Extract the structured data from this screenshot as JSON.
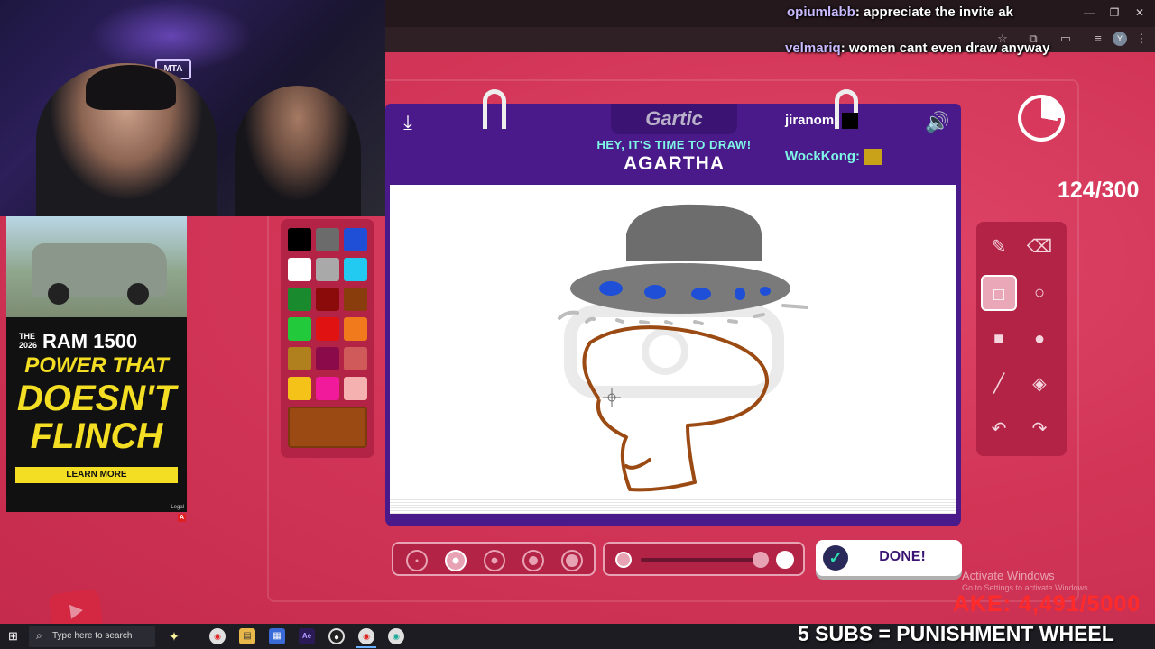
{
  "overlay_chat": [
    {
      "user": "opiumlabb",
      "message": "appreciate the invite ak"
    },
    {
      "user": "velmariq",
      "message": "women cant even draw anyway"
    }
  ],
  "game": {
    "logo": "Gartic",
    "prompt_heading": "HEY, IT'S TIME TO DRAW!",
    "word": "AGARTHA",
    "players": [
      {
        "name": "jiranom:"
      },
      {
        "name": "WockKong:"
      }
    ],
    "done_label": "DONE!",
    "colors": [
      "#000000",
      "#6b6b6b",
      "#1f4fd6",
      "#ffffff",
      "#a9a9a9",
      "#22c9f0",
      "#1a8a2e",
      "#8b0a0a",
      "#8a3d0c",
      "#22c93a",
      "#e01212",
      "#f07a1c",
      "#b0801f",
      "#8b0a4a",
      "#d05a5a",
      "#f5c21a",
      "#f01a9a",
      "#f5b0b0"
    ],
    "selected_color": "#9a4a12",
    "active_tool": "rectangle-outline",
    "tools": [
      "pencil",
      "eraser",
      "rectangle-outline",
      "ellipse-outline",
      "rectangle-filled",
      "ellipse-filled",
      "line",
      "fill-bucket",
      "undo",
      "redo"
    ],
    "selected_brush_size": 2,
    "opacity_level": 1.0
  },
  "stream": {
    "counter": "124/300",
    "subs_goal": "AKE: 4,491/5000",
    "punishment": "5 SUBS = PUNISHMENT WHEEL",
    "activate_title": "Activate Windows",
    "activate_sub": "Go to Settings to activate Windows."
  },
  "webcam": {
    "sign_text": "MTA"
  },
  "ad": {
    "year": "THE 2026",
    "model": "RAM 1500",
    "line1": "POWER THAT",
    "line2": "DOESN'T",
    "line3": "FLINCH",
    "button": "LEARN MORE",
    "legal": "Legal",
    "badge": "A"
  },
  "taskbar": {
    "search_placeholder": "Type here to search"
  }
}
